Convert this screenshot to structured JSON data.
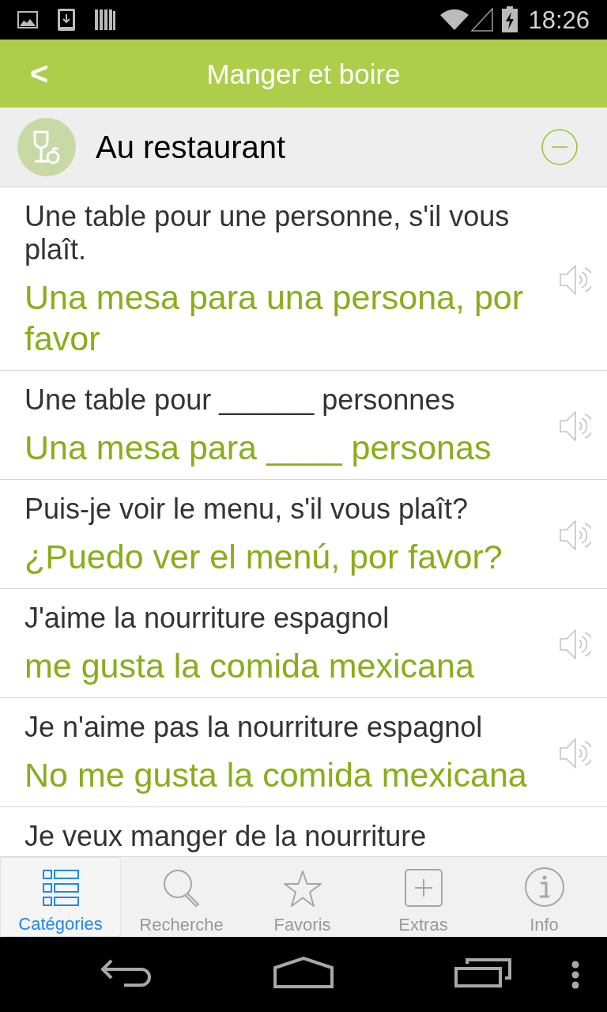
{
  "status_bar": {
    "time": "18:26"
  },
  "header": {
    "back": "<",
    "title": "Manger et boire"
  },
  "category": {
    "title": "Au restaurant",
    "expanded": true
  },
  "phrases": [
    {
      "french": "Une table pour une personne, s'il vous plaît.",
      "spanish": "Una mesa para una persona, por favor"
    },
    {
      "french": "Une table pour ______ personnes",
      "spanish": "Una mesa para ____ personas"
    },
    {
      "french": "Puis-je voir le menu, s'il vous plaît?",
      "spanish": "¿Puedo ver el menú, por favor?"
    },
    {
      "french": "J'aime la nourriture espagnol",
      "spanish": "me gusta la comida mexicana"
    },
    {
      "french": "Je n'aime pas la nourriture espagnol",
      "spanish": "No me gusta la comida mexicana"
    },
    {
      "french": "Je veux manger de la nourriture"
    }
  ],
  "tabs": [
    {
      "kind": "categories",
      "label": "Catégories",
      "selected": true
    },
    {
      "kind": "search",
      "label": "Recherche",
      "selected": false
    },
    {
      "kind": "favorites",
      "label": "Favoris",
      "selected": false
    },
    {
      "kind": "extras",
      "label": "Extras",
      "selected": false
    },
    {
      "kind": "info",
      "label": "Info",
      "selected": false
    }
  ]
}
